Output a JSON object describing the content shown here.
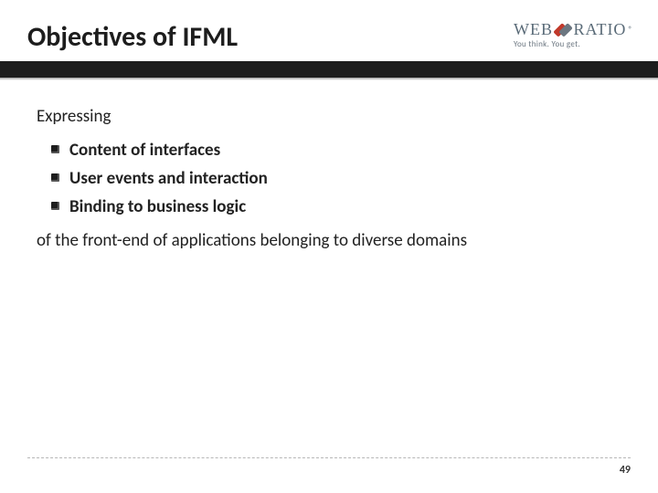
{
  "title": "Objectives of IFML",
  "logo": {
    "part1": "WEB",
    "part2": "RATIO",
    "reg": "®",
    "tagline": "You think. You get."
  },
  "lead": "Expressing",
  "bullets": [
    "Content of interfaces",
    "User events and interaction",
    "Binding to business logic"
  ],
  "tail": "of the front-end of applications belonging to diverse domains",
  "page_number": "49"
}
